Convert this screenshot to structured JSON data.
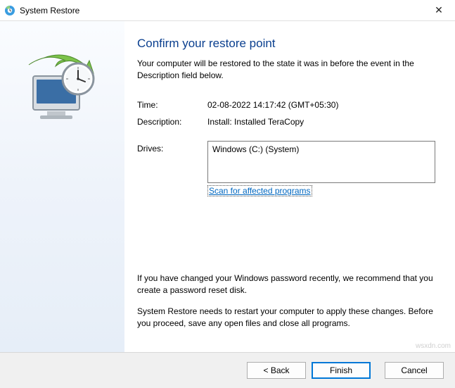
{
  "window": {
    "title": "System Restore"
  },
  "heading": "Confirm your restore point",
  "subtext": "Your computer will be restored to the state it was in before the event in the Description field below.",
  "fields": {
    "time_label": "Time:",
    "time_value": "02-08-2022 14:17:42 (GMT+05:30)",
    "description_label": "Description:",
    "description_value": "Install: Installed TeraCopy",
    "drives_label": "Drives:",
    "drives_value": "Windows (C:) (System)"
  },
  "scan_link": "Scan for affected programs",
  "notes": {
    "password_note": "If you have changed your Windows password recently, we recommend that you create a password reset disk.",
    "restart_note": "System Restore needs to restart your computer to apply these changes. Before you proceed, save any open files and close all programs."
  },
  "buttons": {
    "back": "< Back",
    "finish": "Finish",
    "cancel": "Cancel"
  },
  "watermark": "wsxdn.com"
}
